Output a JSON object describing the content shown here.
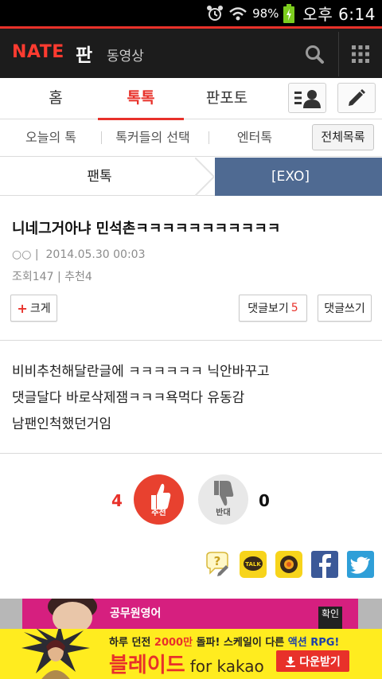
{
  "status_bar": {
    "battery_pct": "98%",
    "time": "오후 6:14"
  },
  "app_header": {
    "logo": "NATE",
    "section": "판",
    "subsection": "동영상"
  },
  "main_tabs": [
    {
      "label": "홈"
    },
    {
      "label": "톡톡"
    },
    {
      "label": "판포토"
    }
  ],
  "sub_tabs": [
    {
      "label": "오늘의 톡"
    },
    {
      "label": "톡커들의 선택"
    },
    {
      "label": "엔터톡"
    }
  ],
  "all_list_label": "전체목록",
  "breadcrumb": {
    "left": "팬톡",
    "right": "[EXO]"
  },
  "article": {
    "title": "니네그거아냐 민석촌ㅋㅋㅋㅋㅋㅋㅋㅋㅋㅋㅋ",
    "author": "○○",
    "date": "2014.05.30 00:03",
    "views_label": "조회",
    "views": "147",
    "recommend_label": "추천",
    "recommend": "4",
    "body_lines": [
      "비비추천해달란글에 ㅋㅋㅋㅋㅋㅋ 닉안바꾸고",
      "댓글달다 바로삭제잼ㅋㅋㅋ욕먹다 유동감",
      "남팬인척했던거임"
    ]
  },
  "buttons": {
    "bigger_plus": "+",
    "bigger": "크게",
    "view_comments": "댓글보기",
    "comment_count": "5",
    "write_comment": "댓글쓰기"
  },
  "vote": {
    "up_count": "4",
    "up_label": "추천",
    "down_label": "반대",
    "down_count": "0"
  },
  "share_icons": [
    "qna-icon",
    "kakaotalk-icon",
    "kakaostory-icon",
    "facebook-icon",
    "twitter-icon"
  ],
  "ads": {
    "ad1_text": "공무원영어",
    "ad1_btn": "확인",
    "ad2_top_1": "하루 던전 ",
    "ad2_top_2": "2000만",
    "ad2_top_3": " 돌파! 스케일이 다른 ",
    "ad2_top_4": "액션 RPG!",
    "ad2_title": "블레이드",
    "ad2_kakao": "for kakao",
    "ad2_download": "다운받기"
  },
  "colors": {
    "accent": "#e8312a",
    "header_bg": "#1c1c1c",
    "crumb_active": "#4f6a92",
    "ad_yellow": "#ffec1f"
  }
}
